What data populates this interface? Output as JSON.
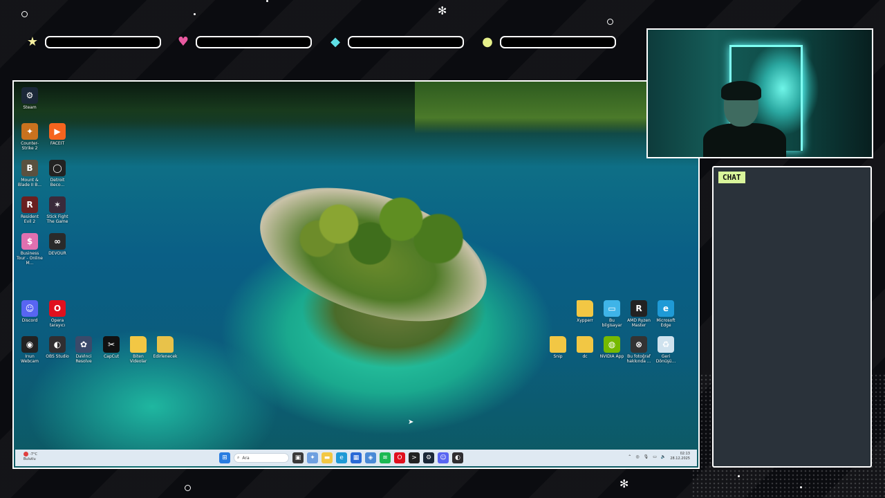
{
  "overlay": {
    "stat_bars": [
      {
        "icon": "star-icon",
        "color": "#f6f0a0"
      },
      {
        "icon": "heart-icon",
        "color": "#e85aa0"
      },
      {
        "icon": "diamond-icon",
        "color": "#5fe0e6"
      },
      {
        "icon": "orb-icon",
        "color": "#e6f08a"
      }
    ],
    "chat_label": "CHAT"
  },
  "desktop": {
    "left_icons": [
      {
        "label": "Steam",
        "icon": "steam-icon",
        "color": "#1b2838"
      },
      {
        "label": "Counter-Strike 2",
        "icon": "cs2-icon",
        "color": "#c9721e"
      },
      {
        "label": "FACEIT",
        "icon": "faceit-icon",
        "color": "#f5641e"
      },
      {
        "label": "Mount & Blade II B...",
        "icon": "bannerlord-icon",
        "color": "#5a5140"
      },
      {
        "label": "Detroit Beco...",
        "icon": "detroit-icon",
        "color": "#222222"
      },
      {
        "label": "Resident Evil 2",
        "icon": "re2-icon",
        "color": "#6a2020"
      },
      {
        "label": "Stick Fight The Game",
        "icon": "stickfight-icon",
        "color": "#3a2a3a"
      },
      {
        "label": "Business Tour - Online M...",
        "icon": "businesstour-icon",
        "color": "#e070b0"
      },
      {
        "label": "DEVOUR",
        "icon": "devour-icon",
        "color": "#2a2a2a"
      }
    ],
    "bottom_icons": [
      {
        "label": "Discord",
        "icon": "discord-icon",
        "color": "#5865f2"
      },
      {
        "label": "Opera tarayıcı",
        "icon": "opera-icon",
        "color": "#e0101e"
      },
      {
        "label": "Irıun Webcam",
        "icon": "iriun-icon",
        "color": "#222222"
      },
      {
        "label": "OBS Studio",
        "icon": "obs-icon",
        "color": "#302e31"
      },
      {
        "label": "DaVinci Resolve",
        "icon": "davinci-icon",
        "color": "#3a4a6a"
      },
      {
        "label": "CapCut",
        "icon": "capcut-icon",
        "color": "#111111"
      },
      {
        "label": "Biten Videolar",
        "icon": "folder-icon",
        "color": "#f2c744"
      },
      {
        "label": "Edirlenecek",
        "icon": "folder-icon",
        "color": "#e8c24a"
      }
    ],
    "right_icons": [
      {
        "label": "Xypperr",
        "icon": "folder-icon",
        "color": "#f2c744"
      },
      {
        "label": "Bu bilgisayar",
        "icon": "computer-icon",
        "color": "#3fb4e8"
      },
      {
        "label": "AMD Ryzen Master",
        "icon": "ryzen-icon",
        "color": "#222222"
      },
      {
        "label": "Microsoft Edge",
        "icon": "edge-icon",
        "color": "#1f9ad6"
      },
      {
        "label": "Snip",
        "icon": "folder-icon",
        "color": "#f2c744"
      },
      {
        "label": "dc",
        "icon": "folder-icon",
        "color": "#f2c744"
      },
      {
        "label": "NVIDIA App",
        "icon": "nvidia-icon",
        "color": "#76b900"
      },
      {
        "label": "Bu fotoğraf hakkında ...",
        "icon": "camera-icon",
        "color": "#333333"
      },
      {
        "label": "Geri Dönüşü...",
        "icon": "recycle-bin-icon",
        "color": "#cfe2ee"
      }
    ]
  },
  "taskbar": {
    "weather_temp": "-7°C",
    "weather_desc": "Bulutlu",
    "search_placeholder": "Ara",
    "time": "02:13",
    "date": "28.12.2025",
    "apps": [
      {
        "icon": "windows-start-icon",
        "color": "#2a7de1"
      },
      {
        "icon": "task-view-icon",
        "color": "#3a3a3a"
      },
      {
        "icon": "widgets-icon",
        "color": "#6fa0e0"
      },
      {
        "icon": "file-explorer-icon",
        "color": "#f2c744"
      },
      {
        "icon": "edge-icon",
        "color": "#1f9ad6"
      },
      {
        "icon": "store-icon",
        "color": "#2a6ad6"
      },
      {
        "icon": "app-icon",
        "color": "#4a8ad6"
      },
      {
        "icon": "spotify-icon",
        "color": "#1db954"
      },
      {
        "icon": "opera-icon",
        "color": "#e0101e"
      },
      {
        "icon": "terminal-icon",
        "color": "#222222"
      },
      {
        "icon": "steam-icon",
        "color": "#1b2838"
      },
      {
        "icon": "discord-icon",
        "color": "#5865f2"
      },
      {
        "icon": "obs-icon",
        "color": "#302e31"
      }
    ]
  }
}
